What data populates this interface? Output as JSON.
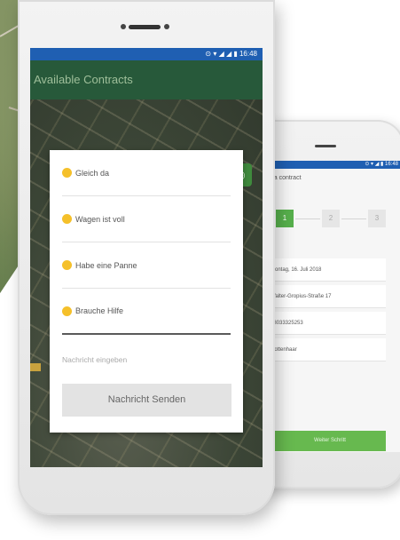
{
  "phone_main": {
    "status_time": "16:48",
    "app_title": "Available Contracts",
    "dialog": {
      "options": [
        {
          "label": "Gleich da",
          "icon": "sunglasses-emoji-icon"
        },
        {
          "label": "Wagen ist voll",
          "icon": "smile-emoji-icon"
        },
        {
          "label": "Habe eine Panne",
          "icon": "tired-emoji-icon"
        },
        {
          "label": "Brauche Hilfe",
          "icon": "sad-emoji-icon"
        }
      ],
      "message_placeholder": "Nachricht eingeben",
      "send_button": "Nachricht Senden"
    }
  },
  "phone_secondary": {
    "title": "te a contract",
    "steps": [
      "1",
      "2",
      "3"
    ],
    "fields": [
      "Montag, 16. Juli 2018",
      "Walter-Gropius-Straße 17",
      "08033325253",
      "Rottenhaar"
    ],
    "button": "Weiter Schritt"
  },
  "colors": {
    "status_bar": "#1f5fb2",
    "app_bar": "#27593a",
    "accent_green": "#57b04c"
  }
}
